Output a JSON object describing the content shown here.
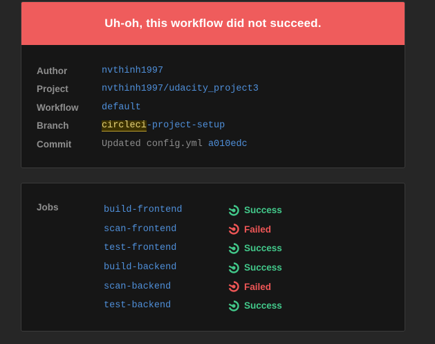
{
  "banner": {
    "message": "Uh-oh, this workflow did not succeed.",
    "color": "#ef5c5c"
  },
  "meta": {
    "author_label": "Author",
    "author": "nvthinh1997",
    "project_label": "Project",
    "project": "nvthinh1997/udacity_project3",
    "workflow_label": "Workflow",
    "workflow": "default",
    "branch_label": "Branch",
    "branch_highlight": "circleci",
    "branch_rest": "-project-setup",
    "commit_label": "Commit",
    "commit_message": "Updated config.yml",
    "commit_hash": "a010edc"
  },
  "jobs": {
    "label": "Jobs",
    "items": [
      {
        "name": "build-frontend",
        "status": "Success",
        "icon": "success-icon"
      },
      {
        "name": "scan-frontend",
        "status": "Failed",
        "icon": "failed-icon"
      },
      {
        "name": "test-frontend",
        "status": "Success",
        "icon": "success-icon"
      },
      {
        "name": "build-backend",
        "status": "Success",
        "icon": "success-icon"
      },
      {
        "name": "scan-backend",
        "status": "Failed",
        "icon": "failed-icon"
      },
      {
        "name": "test-backend",
        "status": "Success",
        "icon": "success-icon"
      }
    ]
  },
  "colors": {
    "success": "#42c88a",
    "failed": "#ee5656",
    "link": "#4f8fd9"
  }
}
